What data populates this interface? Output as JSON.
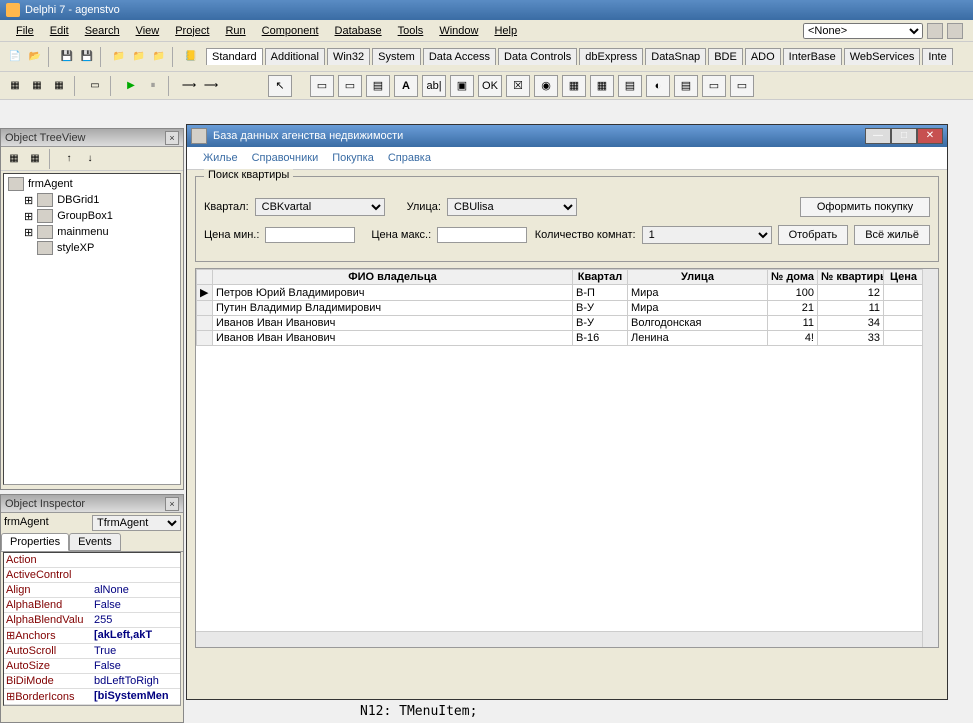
{
  "ide": {
    "title": "Delphi 7 - agenstvo",
    "menu": [
      "File",
      "Edit",
      "Search",
      "View",
      "Project",
      "Run",
      "Component",
      "Database",
      "Tools",
      "Window",
      "Help"
    ],
    "none_option": "<None>",
    "tabs": [
      "Standard",
      "Additional",
      "Win32",
      "System",
      "Data Access",
      "Data Controls",
      "dbExpress",
      "DataSnap",
      "BDE",
      "ADO",
      "InterBase",
      "WebServices",
      "Inte"
    ]
  },
  "treeview": {
    "title": "Object TreeView",
    "root": "frmAgent",
    "items": [
      "DBGrid1",
      "GroupBox1",
      "mainmenu",
      "styleXP"
    ]
  },
  "inspector": {
    "title": "Object Inspector",
    "object_name": "frmAgent",
    "object_class": "TfrmAgent",
    "tabs": [
      "Properties",
      "Events"
    ],
    "props": [
      {
        "k": "Action",
        "v": ""
      },
      {
        "k": "ActiveControl",
        "v": ""
      },
      {
        "k": "Align",
        "v": "alNone"
      },
      {
        "k": "AlphaBlend",
        "v": "False"
      },
      {
        "k": "AlphaBlendValu",
        "v": "255"
      },
      {
        "k": "⊞Anchors",
        "v": "[akLeft,akT"
      },
      {
        "k": "AutoScroll",
        "v": "True"
      },
      {
        "k": "AutoSize",
        "v": "False"
      },
      {
        "k": "BiDiMode",
        "v": "bdLeftToRigh"
      },
      {
        "k": "⊞BorderIcons",
        "v": "[biSystemMen"
      }
    ]
  },
  "form": {
    "title": "База данных агенства недвижимости",
    "menu": [
      "Жилье",
      "Справочники",
      "Покупка",
      "Справка"
    ],
    "group_title": "Поиск квартиры",
    "labels": {
      "kvartal": "Квартал:",
      "ulica": "Улица:",
      "price_min": "Цена мин.:",
      "price_max": "Цена макс.:",
      "rooms": "Количество комнат:"
    },
    "values": {
      "kvartal": "CBKvartal",
      "ulica": "CBUlisa",
      "rooms": "1"
    },
    "buttons": {
      "buy": "Оформить покупку",
      "select": "Отобрать",
      "all": "Всё жильё"
    },
    "grid": {
      "headers": [
        "ФИО владельца",
        "Квартал",
        "Улица",
        "№ дома",
        "№ квартиры",
        "Цена"
      ],
      "rows": [
        {
          "sel": "▶",
          "fio": "Петров Юрий Владимирович",
          "kv": "В-П",
          "ul": "Мира",
          "dom": "100",
          "flat": "12",
          "price": ""
        },
        {
          "sel": "",
          "fio": "Путин Владимир Владимирович",
          "kv": "В-У",
          "ul": "Мира",
          "dom": "21",
          "flat": "11",
          "price": ""
        },
        {
          "sel": "",
          "fio": "Иванов Иван Иванович",
          "kv": "В-У",
          "ul": "Волгодонская",
          "dom": "11",
          "flat": "34",
          "price": ""
        },
        {
          "sel": "",
          "fio": "Иванов Иван Иванович",
          "kv": "В-16",
          "ul": "Ленина",
          "dom": "4!",
          "flat": "33",
          "price": ""
        }
      ]
    }
  },
  "code_line": "N12: TMenuItem;"
}
